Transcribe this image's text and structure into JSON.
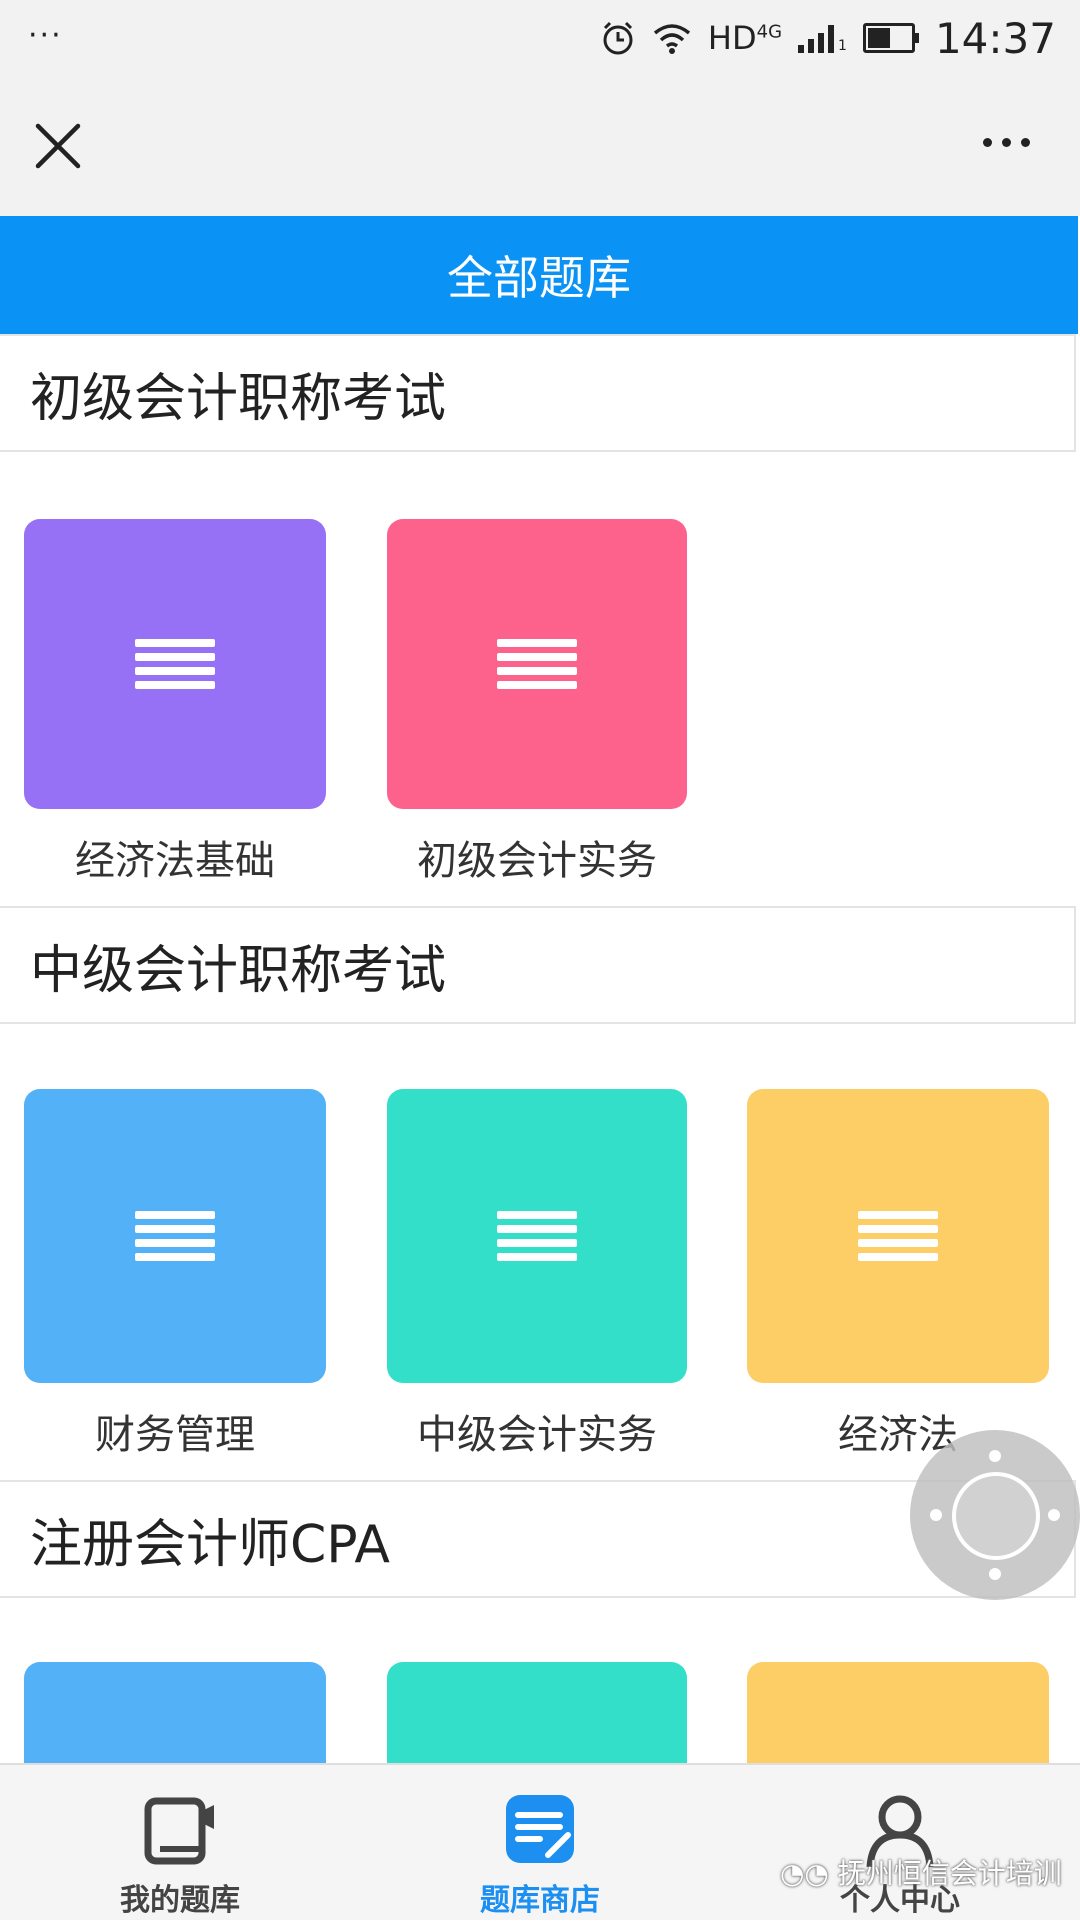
{
  "status_bar": {
    "menu_dots": "···",
    "network": "HD",
    "network_gen": "4G",
    "sim": "1",
    "time": "14:37"
  },
  "titlebar": {
    "close_icon": "close-icon",
    "more_icon": "more-icon"
  },
  "banner": {
    "title": "全部题库"
  },
  "sections": [
    {
      "title": "初级会计职称考试",
      "items": [
        {
          "label": "经济法基础",
          "color": "#9670f5"
        },
        {
          "label": "初级会计实务",
          "color": "#fd628c"
        }
      ]
    },
    {
      "title": "中级会计职称考试",
      "items": [
        {
          "label": "财务管理",
          "color": "#53b2f7"
        },
        {
          "label": "中级会计实务",
          "color": "#33dfc8"
        },
        {
          "label": "经济法",
          "color": "#fdcd66"
        }
      ]
    },
    {
      "title": "注册会计师CPA",
      "items": [
        {
          "color": "#53b2f7"
        },
        {
          "color": "#33dfc8"
        },
        {
          "color": "#fdcd66"
        }
      ]
    }
  ],
  "bottom_nav": [
    {
      "label": "我的题库",
      "icon": "book-icon",
      "active": false
    },
    {
      "label": "题库商店",
      "icon": "store-icon",
      "active": true
    },
    {
      "label": "个人中心",
      "icon": "person-icon",
      "active": false
    }
  ],
  "watermark": "抚州恒信会计培训",
  "colors": {
    "accent": "#0a93f5",
    "nav_active": "#1c8ff0"
  }
}
